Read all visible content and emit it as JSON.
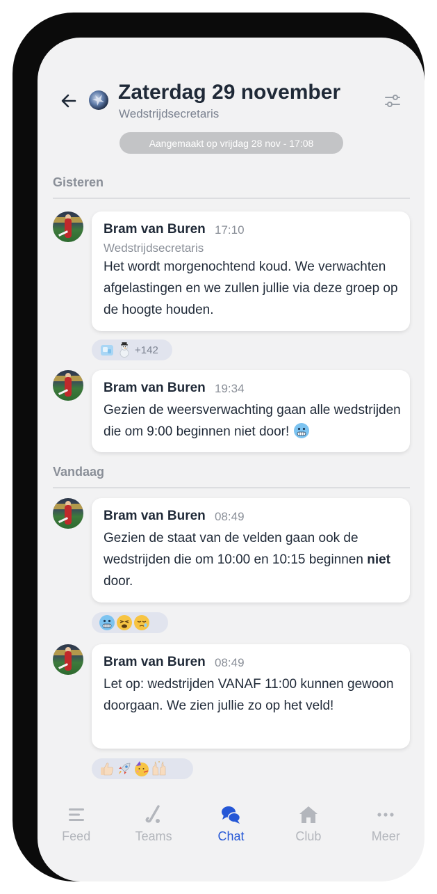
{
  "header": {
    "title": "Zaterdag 29 november",
    "subtitle": "Wedstrijdsecretaris",
    "created": "Aangemaakt op vrijdag 28 nov - 17:08"
  },
  "days": [
    {
      "label": "Gisteren"
    },
    {
      "label": "Vandaag"
    }
  ],
  "messages": [
    {
      "sender": "Bram van Buren",
      "time": "17:10",
      "role": "Wedstrijdsecretaris",
      "text": "Het wordt morgenochtend koud. We verwachten afgelastingen en we zullen jullie via deze groep op de hoogte houden.",
      "reactions": {
        "emojis": [
          "ice-cube",
          "snowman"
        ],
        "count": "+142"
      }
    },
    {
      "sender": "Bram van Buren",
      "time": "19:34",
      "text": "Gezien de weersverwachting gaan alle wedstrijden die om 9:00 beginnen niet door!"
    },
    {
      "sender": "Bram van Buren",
      "time": "08:49",
      "text_before": "Gezien de staat van de velden gaan ook de wedstrijden die om 10:00 en 10:15 beginnen ",
      "text_bold": "niet",
      "text_after": " door.",
      "reactions": {
        "emojis": [
          "cold-face",
          "weary-face",
          "sleepy-face"
        ]
      }
    },
    {
      "sender": "Bram van Buren",
      "time": "08:49",
      "text": "Let op: wedstrijden VANAF 11:00 kunnen gewoon doorgaan. We zien jullie zo op het veld!",
      "reactions": {
        "emojis": [
          "thumbs-up",
          "rocket",
          "partying-face",
          "raised-hands"
        ]
      }
    }
  ],
  "nav": [
    {
      "label": "Feed",
      "icon": "feed-icon",
      "active": false
    },
    {
      "label": "Teams",
      "icon": "hockey-stick-icon",
      "active": false
    },
    {
      "label": "Chat",
      "icon": "chat-bubbles-icon",
      "active": true
    },
    {
      "label": "Club",
      "icon": "home-icon",
      "active": false
    },
    {
      "label": "Meer",
      "icon": "more-dots-icon",
      "active": false
    }
  ],
  "colors": {
    "accent": "#2557d6",
    "background": "#f2f2f3",
    "pill": "#c3c4c6",
    "reaction_bg": "#e1e4ee"
  }
}
